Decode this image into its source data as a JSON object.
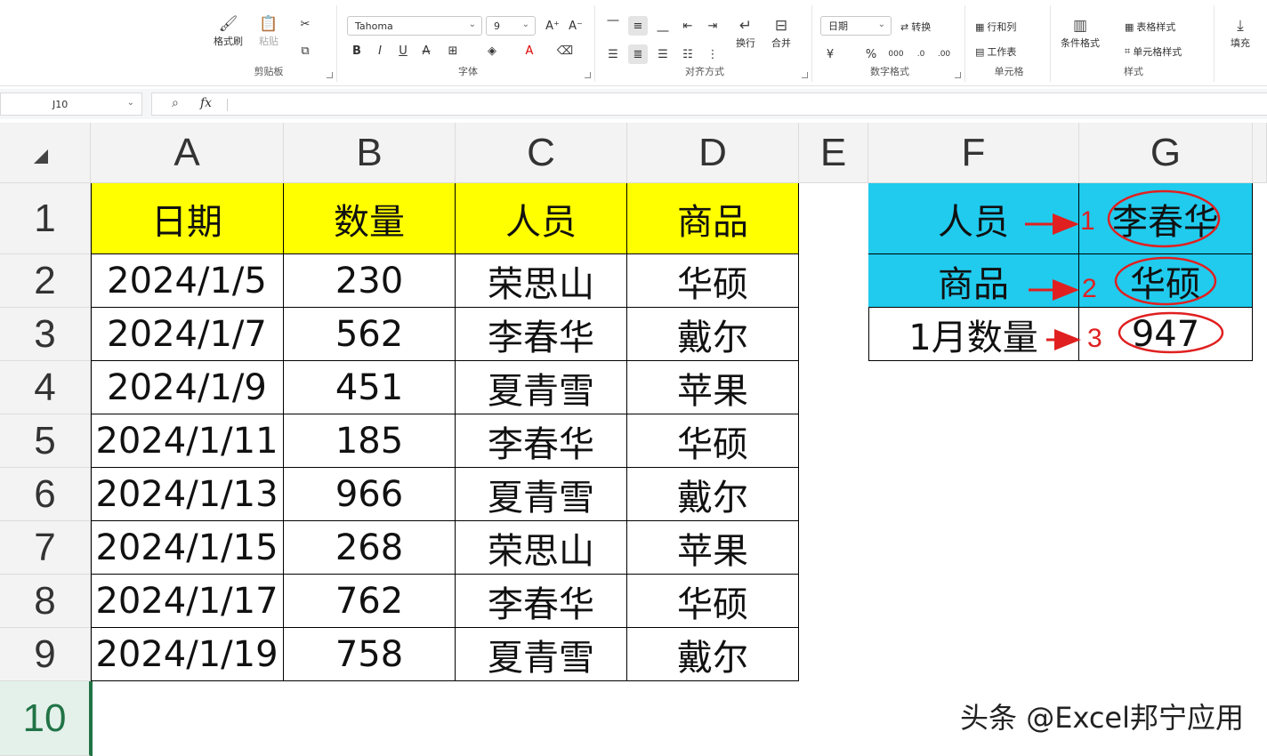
{
  "ribbon": {
    "clipboard": {
      "label": "剪贴板",
      "format_painter": "格式刷",
      "paste": "粘贴"
    },
    "font": {
      "label": "字体",
      "name": "Tahoma",
      "size": "9",
      "bold": "B",
      "italic": "I",
      "underline": "U",
      "strike": "A"
    },
    "align": {
      "label": "对齐方式",
      "wrap": "换行",
      "merge": "合并"
    },
    "number": {
      "label": "数字格式",
      "format": "日期",
      "convert": "转换",
      "currency": "¥",
      "percent": "%",
      "thousands": "000"
    },
    "cells": {
      "label": "单元格",
      "rows_cols": "行和列",
      "worksheet": "工作表"
    },
    "styles": {
      "label": "样式",
      "conditional": "条件格式",
      "table_style": "表格样式",
      "cell_style": "单元格样式"
    },
    "fill": {
      "label": "填充"
    }
  },
  "formula_bar": {
    "name_box": "J10",
    "fx": "fx",
    "value": ""
  },
  "columns": [
    "A",
    "B",
    "C",
    "D",
    "E",
    "F",
    "G"
  ],
  "rows": [
    "1",
    "2",
    "3",
    "4",
    "5",
    "6",
    "7",
    "8",
    "9",
    "10"
  ],
  "table": {
    "headers": [
      "日期",
      "数量",
      "人员",
      "商品"
    ],
    "rows": [
      [
        "2024/1/5",
        "230",
        "荣思山",
        "华硕"
      ],
      [
        "2024/1/7",
        "562",
        "李春华",
        "戴尔"
      ],
      [
        "2024/1/9",
        "451",
        "夏青雪",
        "苹果"
      ],
      [
        "2024/1/11",
        "185",
        "李春华",
        "华硕"
      ],
      [
        "2024/1/13",
        "966",
        "夏青雪",
        "戴尔"
      ],
      [
        "2024/1/15",
        "268",
        "荣思山",
        "苹果"
      ],
      [
        "2024/1/17",
        "762",
        "李春华",
        "华硕"
      ],
      [
        "2024/1/19",
        "758",
        "夏青雪",
        "戴尔"
      ]
    ]
  },
  "lookup": {
    "rows": [
      {
        "label": "人员",
        "value": "李春华",
        "marker": "1"
      },
      {
        "label": "商品",
        "value": "华硕",
        "marker": "2"
      },
      {
        "label": "1月数量",
        "value": "947",
        "marker": "3"
      }
    ]
  },
  "watermark": "头条 @Excel邦宁应用",
  "colors": {
    "header_yellow": "#ffff00",
    "lookup_cyan": "#20cbee",
    "annotation_red": "#e02020",
    "selection_green": "#217346"
  }
}
